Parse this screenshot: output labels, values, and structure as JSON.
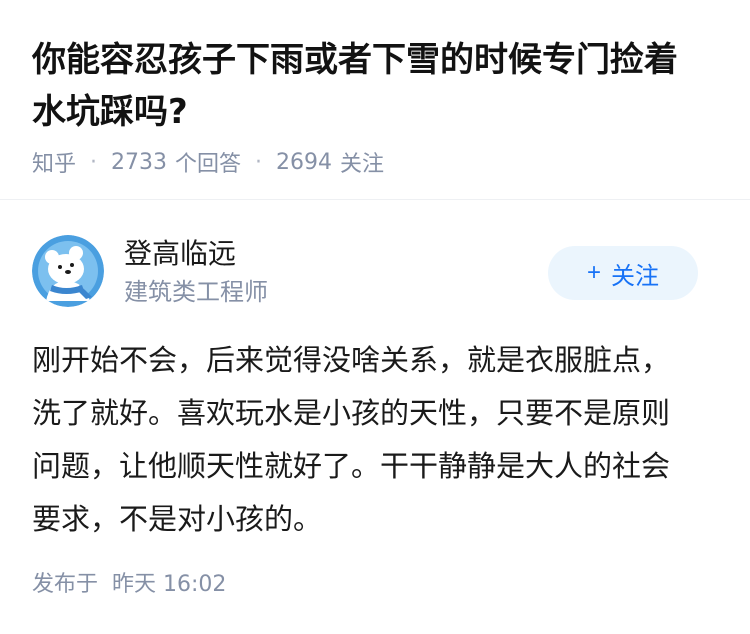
{
  "question": {
    "title_line1": "你能容忍孩子下雨或者下雪的时候专门捡着",
    "title_line2": "水坑踩吗?",
    "source": "知乎",
    "answer_count": "2733",
    "answer_label": "个回答",
    "follow_count": "2694",
    "follow_label": "关注"
  },
  "author": {
    "name": "登高临远",
    "bio": "建筑类工程师",
    "avatar_icon": "bear-avatar-icon",
    "follow_button": {
      "plus": "+",
      "label": "关注"
    }
  },
  "answer": {
    "line1": "刚开始不会，后来觉得没啥关系，就是衣服脏点，",
    "line2": "洗了就好。喜欢玩水是小孩的天性，只要不是原则",
    "line3": "问题，让他顺天性就好了。干干静静是大人的社会",
    "line4": "要求，不是对小孩的。"
  },
  "footer": {
    "published_label": "发布于",
    "published_time": "昨天 16:02"
  },
  "colors": {
    "accent": "#1772f6",
    "follow_bg": "#ebf5fd",
    "meta_gray": "#8590a6",
    "avatar_bg": "#4a9fe0"
  }
}
